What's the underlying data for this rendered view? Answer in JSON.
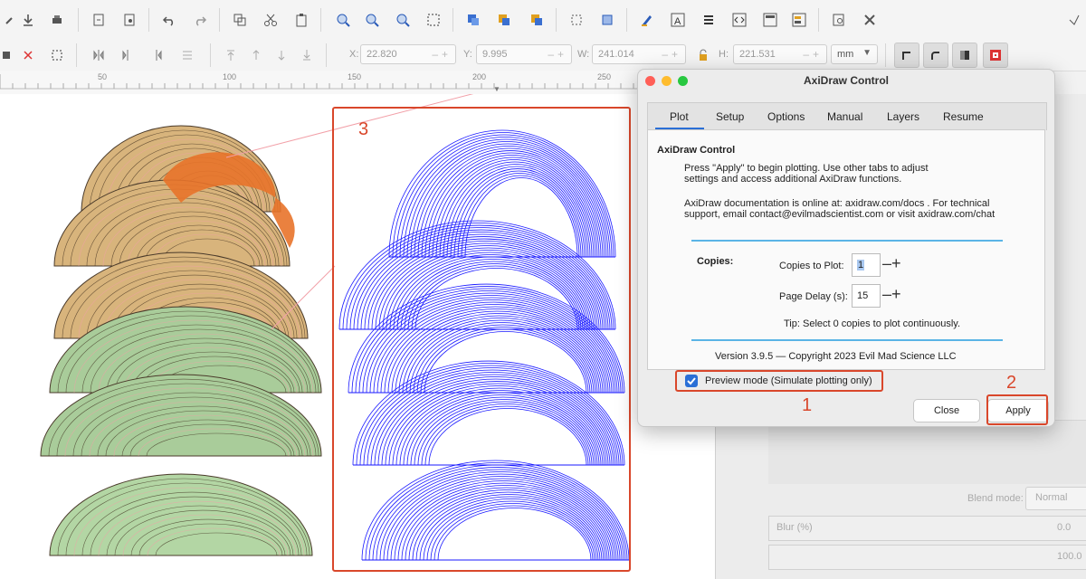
{
  "toolbar": {
    "x_label": "X:",
    "x_value": "22.820",
    "y_label": "Y:",
    "y_value": "9.995",
    "w_label": "W:",
    "w_value": "241.014",
    "h_label": "H:",
    "h_value": "221.531",
    "unit": "mm"
  },
  "ruler": {
    "ticks": [
      "50",
      "100",
      "150",
      "200",
      "250"
    ]
  },
  "dialog": {
    "title": "AxiDraw Control",
    "tabs": [
      "Plot",
      "Setup",
      "Options",
      "Manual",
      "Layers",
      "Resume"
    ],
    "active_tab": "Plot",
    "heading": "AxiDraw Control",
    "para1_line1": "Press \"Apply\" to begin plotting. Use other tabs to adjust",
    "para1_line2": "settings and access additional AxiDraw functions.",
    "para2_line1": "AxiDraw documentation is online at: axidraw.com/docs . For technical",
    "para2_line2": "support, email  contact@evilmadscientist.com  or visit axidraw.com/chat",
    "copies_label": "Copies:",
    "copies_to_plot_label": "Copies to Plot:",
    "copies_to_plot_value": "1",
    "page_delay_label": "Page Delay (s):",
    "page_delay_value": "15",
    "tip": "Tip: Select 0 copies to plot continuously.",
    "version": "Version 3.9.5 — Copyright 2023 Evil Mad Science LLC",
    "preview_label": "Preview mode (Simulate plotting only)",
    "preview_checked": true,
    "close_label": "Close",
    "apply_label": "Apply"
  },
  "right_panel": {
    "blend_mode_label": "Blend mode:",
    "blend_mode_value": "Normal",
    "blur_label": "Blur (%)",
    "blur_value": "0.0",
    "opacity_value": "100.0"
  },
  "annotations": {
    "one": "1",
    "two": "2",
    "three": "3"
  },
  "colors": {
    "accent_red": "#d9472b",
    "plot_blue": "#1a1aff",
    "tab_underline": "#2a6fd6"
  }
}
